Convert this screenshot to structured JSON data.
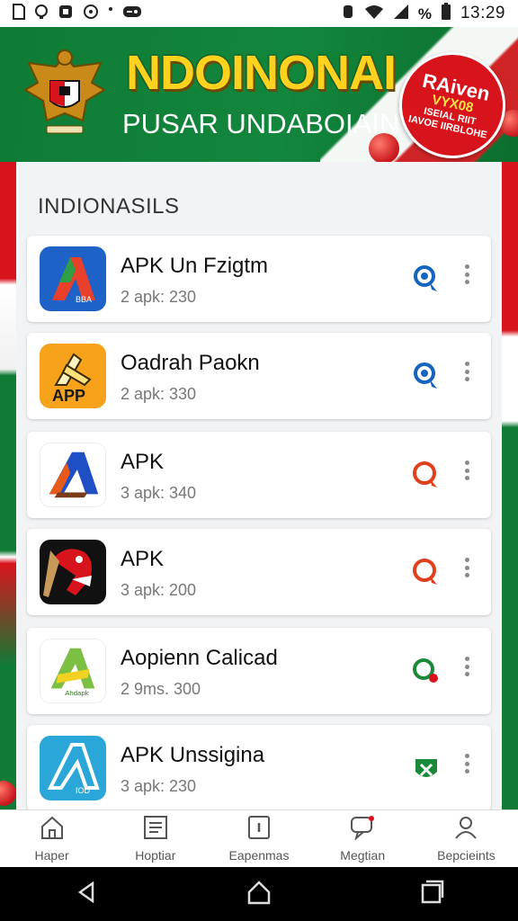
{
  "status_bar": {
    "left_icons": [
      "sd-card-icon",
      "message-icon",
      "sync-icon",
      "more-dot-icon",
      "game-controller-icon"
    ],
    "percent_symbol": "%",
    "time": "13:29"
  },
  "banner": {
    "title": "NDOINONAI",
    "subtitle": "PUSAR UNDABOIAIN",
    "badge_line1": "RAiven",
    "badge_line2": "VYX08",
    "badge_line3": "ISEIAL RIIT\nIAVOE IIRBLOHE",
    "colors": {
      "green": "#0f7b35",
      "red": "#d7141c",
      "gold": "#ffd21f"
    }
  },
  "section": {
    "title": "INDIONASILS"
  },
  "apps": [
    {
      "title": "APK Un Fzigtm",
      "meta": "2 apk: 230",
      "action_icon": "search-badge-icon",
      "action_color": "#1565c0"
    },
    {
      "title": "Oadrah Paokn",
      "meta": "2 apk: 330",
      "action_icon": "search-badge-icon",
      "action_color": "#1565c0"
    },
    {
      "title": "APK",
      "meta": "3 apk: 340",
      "action_icon": "search-badge-icon",
      "action_color": "#e0401c"
    },
    {
      "title": "APK",
      "meta": "3 apk: 200",
      "action_icon": "search-badge-icon",
      "action_color": "#e0401c"
    },
    {
      "title": "Aopienn Calicad",
      "meta": "2 9ms. 300",
      "action_icon": "search-badge-icon",
      "action_color": "#1a8a3a"
    },
    {
      "title": "APK Unssigina",
      "meta": "3 apk: 230",
      "action_icon": "shield-badge-icon",
      "action_color": "#1a8a3a"
    }
  ],
  "app_icon_labels": [
    "BBA",
    "APP",
    "",
    "",
    "Ahdapk",
    "IOD"
  ],
  "bottom_nav": [
    {
      "label": "Haper",
      "icon": "home-icon"
    },
    {
      "label": "Hoptiar",
      "icon": "list-icon"
    },
    {
      "label": "Eapenmas",
      "icon": "info-square-icon"
    },
    {
      "label": "Megtian",
      "icon": "chat-icon"
    },
    {
      "label": "Bepcieints",
      "icon": "person-icon"
    }
  ],
  "system_nav": [
    "back-icon",
    "home-icon",
    "recents-icon"
  ]
}
